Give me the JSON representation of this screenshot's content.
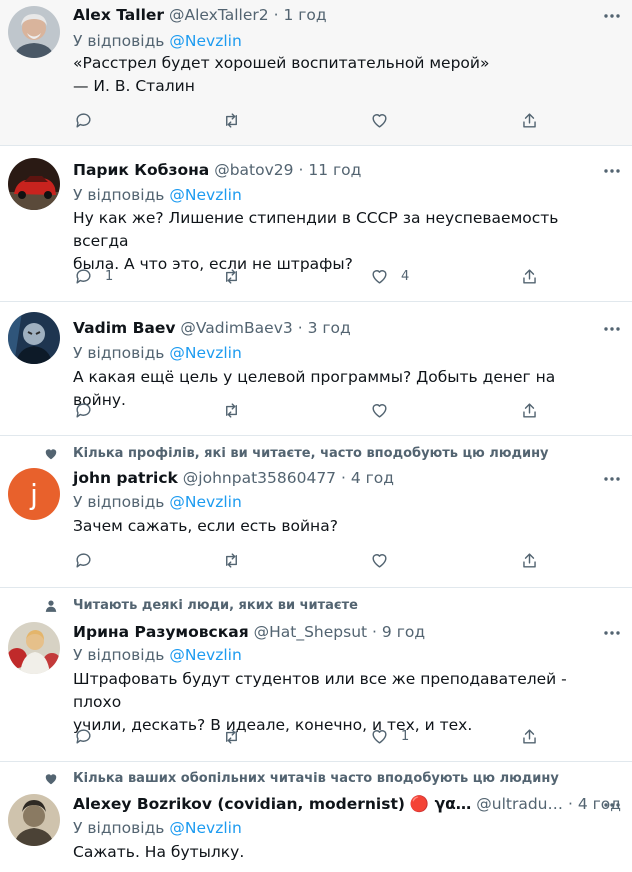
{
  "reply_prefix": "У відповідь",
  "tweets": [
    {
      "name": "Alex Taller",
      "handle": "@AlexTaller2",
      "time": "1 год",
      "mention": "@Nevzlin",
      "text_lines": [
        "«Расстрел будет хорошей воспитательной мерой»",
        "— И. В. Сталин"
      ],
      "avatar": "avatar-photo-gray-haired-man",
      "reply_count": "",
      "like_count": ""
    },
    {
      "name": "Парик Кобзона",
      "handle": "@batov29",
      "time": "11 год",
      "mention": "@Nevzlin",
      "text_lines": [
        "Ну как же? Лишение стипендии в СССР за неуспеваемость всегда",
        "была. А что это, если не штрафы?"
      ],
      "avatar": "avatar-photo-red-car",
      "reply_count": "1",
      "like_count": "4"
    },
    {
      "name": "Vadim Baev",
      "handle": "@VadimBaev3",
      "time": "3 год",
      "mention": "@Nevzlin",
      "text_lines": [
        "А какая ещё цель у целевой программы? Добыть денег на войну."
      ],
      "avatar": "avatar-photo-dark-figure",
      "reply_count": "",
      "like_count": ""
    },
    {
      "context": "Кілька профілів, які ви читаєте, часто вподобують цю людину",
      "context_icon": "heart-icon",
      "name": "john patrick",
      "handle": "@johnpat35860477",
      "time": "4 год",
      "mention": "@Nevzlin",
      "text_lines": [
        "Зачем сажать, если есть война?"
      ],
      "avatar": "avatar-letter-j",
      "avatar_letter": "j",
      "reply_count": "",
      "like_count": ""
    },
    {
      "context": "Читають деякі люди, яких ви читаєте",
      "context_icon": "person-icon",
      "name": "Ирина Разумовская",
      "handle": "@Hat_Shepsut",
      "time": "9 год",
      "mention": "@Nevzlin",
      "text_lines": [
        "Штрафовать будут студентов или все же преподавателей - плохо",
        "учили, дескать? В идеале, конечно, и тех, и тех."
      ],
      "avatar": "avatar-photo-woman-flowers",
      "reply_count": "",
      "like_count": "1"
    },
    {
      "context": "Кілька ваших обопільних читачів часто вподобують цю людину",
      "context_icon": "heart-icon",
      "name": "Alexey Bozrikov (covidian, modernist)",
      "name_extra": "🔴 γα…",
      "handle": "@ultradu…",
      "time": "4 год",
      "mention": "@Nevzlin",
      "text_lines": [
        "Сажать. На бутылку."
      ],
      "avatar": "avatar-photo-sepia-portrait",
      "reply_count": "",
      "like_count": ""
    }
  ],
  "colors": {
    "accent": "#1d9bf0",
    "secondary_text": "#536471",
    "highlight_bg": "#f7f7f7",
    "divider": "#e1e8ed"
  }
}
